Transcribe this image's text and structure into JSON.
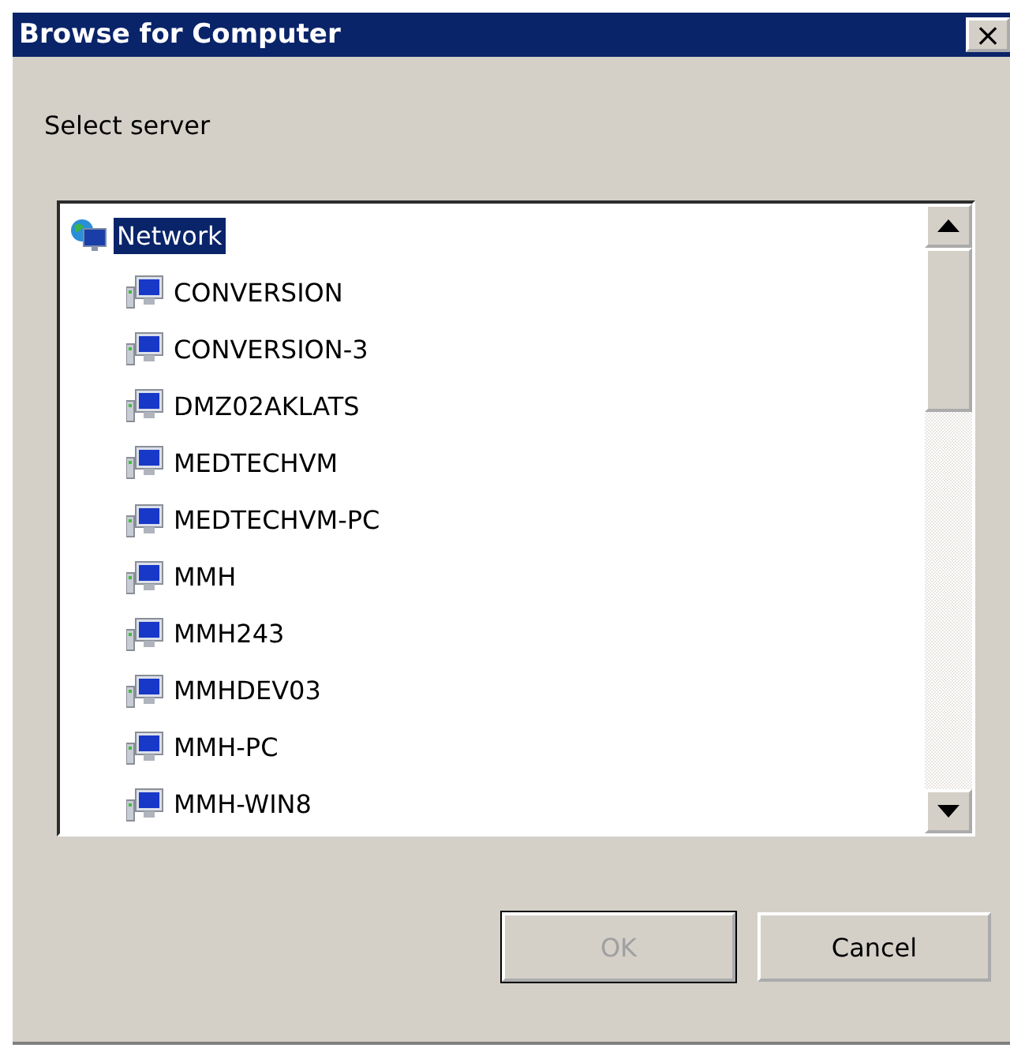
{
  "window": {
    "title": "Browse for Computer",
    "close": "×"
  },
  "prompt": "Select server",
  "tree": [
    {
      "label": "Network",
      "kind": "network",
      "selected": true,
      "expanded": true,
      "children": [
        {
          "label": "CONVERSION",
          "kind": "computer",
          "selected": false
        },
        {
          "label": "CONVERSION-3",
          "kind": "computer",
          "selected": false
        },
        {
          "label": "DMZ02AKLATS",
          "kind": "computer",
          "selected": false
        },
        {
          "label": "MEDTECHVM",
          "kind": "computer",
          "selected": false
        },
        {
          "label": "MEDTECHVM-PC",
          "kind": "computer",
          "selected": false
        },
        {
          "label": "MMH",
          "kind": "computer",
          "selected": false
        },
        {
          "label": "MMH243",
          "kind": "computer",
          "selected": false
        },
        {
          "label": "MMHDEV03",
          "kind": "computer",
          "selected": false
        },
        {
          "label": "MMH-PC",
          "kind": "computer",
          "selected": false
        },
        {
          "label": "MMH-WIN8",
          "kind": "computer",
          "selected": false
        }
      ]
    }
  ],
  "buttons": [
    {
      "label": "OK",
      "disabled": true,
      "default": true
    },
    {
      "label": "Cancel",
      "disabled": false,
      "default": false
    }
  ]
}
